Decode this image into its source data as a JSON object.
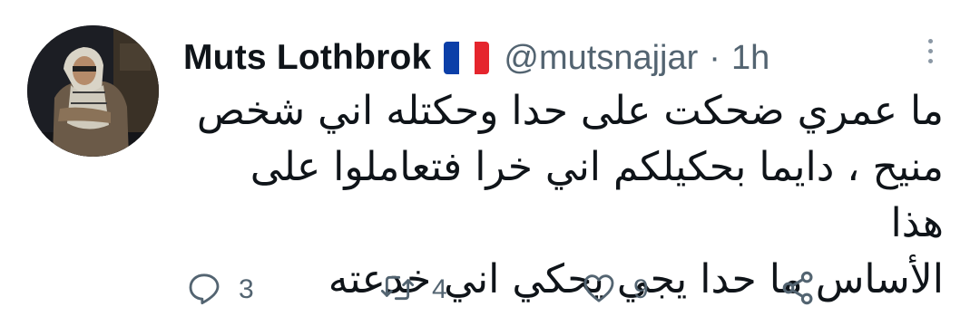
{
  "author": {
    "display_name": "Muts Lothbrok",
    "handle": "@mutsnajjar",
    "separator": "·",
    "time": "1h",
    "flag_colors": [
      "#0b3fa8",
      "#ffffff",
      "#e5252d"
    ]
  },
  "tweet": {
    "lines": [
      "ما عمري ضحكت على حدا وحكتله اني شخص",
      "منيح ، دايما بحكيلكم اني خرا فتعاملوا على هذا",
      "الأساس ما حدا يجي يحكي اني خدعته"
    ]
  },
  "actions": {
    "replies": "3",
    "retweets": "4",
    "likes": "9"
  },
  "icons": {
    "reply": "reply-icon",
    "retweet": "retweet-icon",
    "like": "heart-icon",
    "share": "share-icon",
    "more": "more-icon"
  },
  "colors": {
    "text": "#0f1419",
    "secondary": "#536471"
  }
}
